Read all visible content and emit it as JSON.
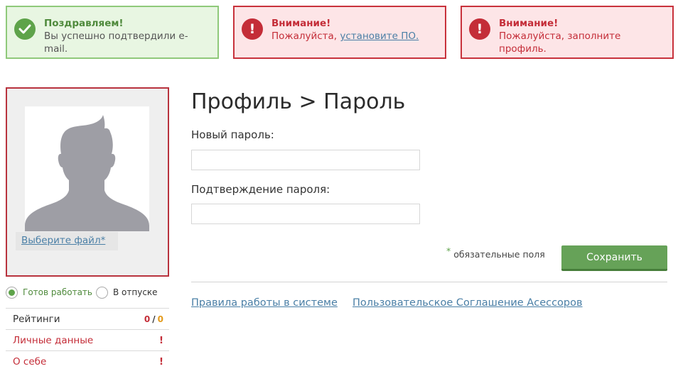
{
  "alerts": [
    {
      "type": "success",
      "title": "Поздравляем!",
      "message": "Вы успешно подтвердили e-mail.",
      "icon": "check-circle-icon"
    },
    {
      "type": "warning",
      "title": "Внимание!",
      "message_prefix": "Пожалуйста, ",
      "link_text": "установите ПО.",
      "icon": "exclamation-circle-icon"
    },
    {
      "type": "warning",
      "title": "Внимание!",
      "message": "Пожалуйста, заполните профиль.",
      "icon": "exclamation-circle-icon"
    }
  ],
  "avatar": {
    "icon": "user-silhouette-icon",
    "file_button": "Выберите файл*"
  },
  "status": {
    "ready_label": "Готов работать",
    "vacation_label": "В отпуске",
    "selected": "ready"
  },
  "side_menu": {
    "ratings_label": "Рейтинги",
    "ratings_count_a": "0",
    "ratings_sep": "/",
    "ratings_count_b": "0",
    "personal_label": "Личные данные",
    "personal_mark": "!",
    "about_label": "О себе",
    "about_mark": "!"
  },
  "form": {
    "title": "Профиль > Пароль",
    "new_password_label": "Новый пароль:",
    "new_password_value": "",
    "confirm_password_label": "Подтверждение пароля:",
    "confirm_password_value": "",
    "required_star": "*",
    "required_note": "обязательные поля",
    "save_label": "Сохранить"
  },
  "footer": {
    "rules_link": "Правила работы в системе",
    "agreement_link": "Пользовательское Соглашение Асессоров"
  },
  "colors": {
    "success": "#5ea34a",
    "warning": "#c42d38",
    "link": "#4a7fa6",
    "button": "#66a258",
    "orange": "#e39a1b"
  }
}
